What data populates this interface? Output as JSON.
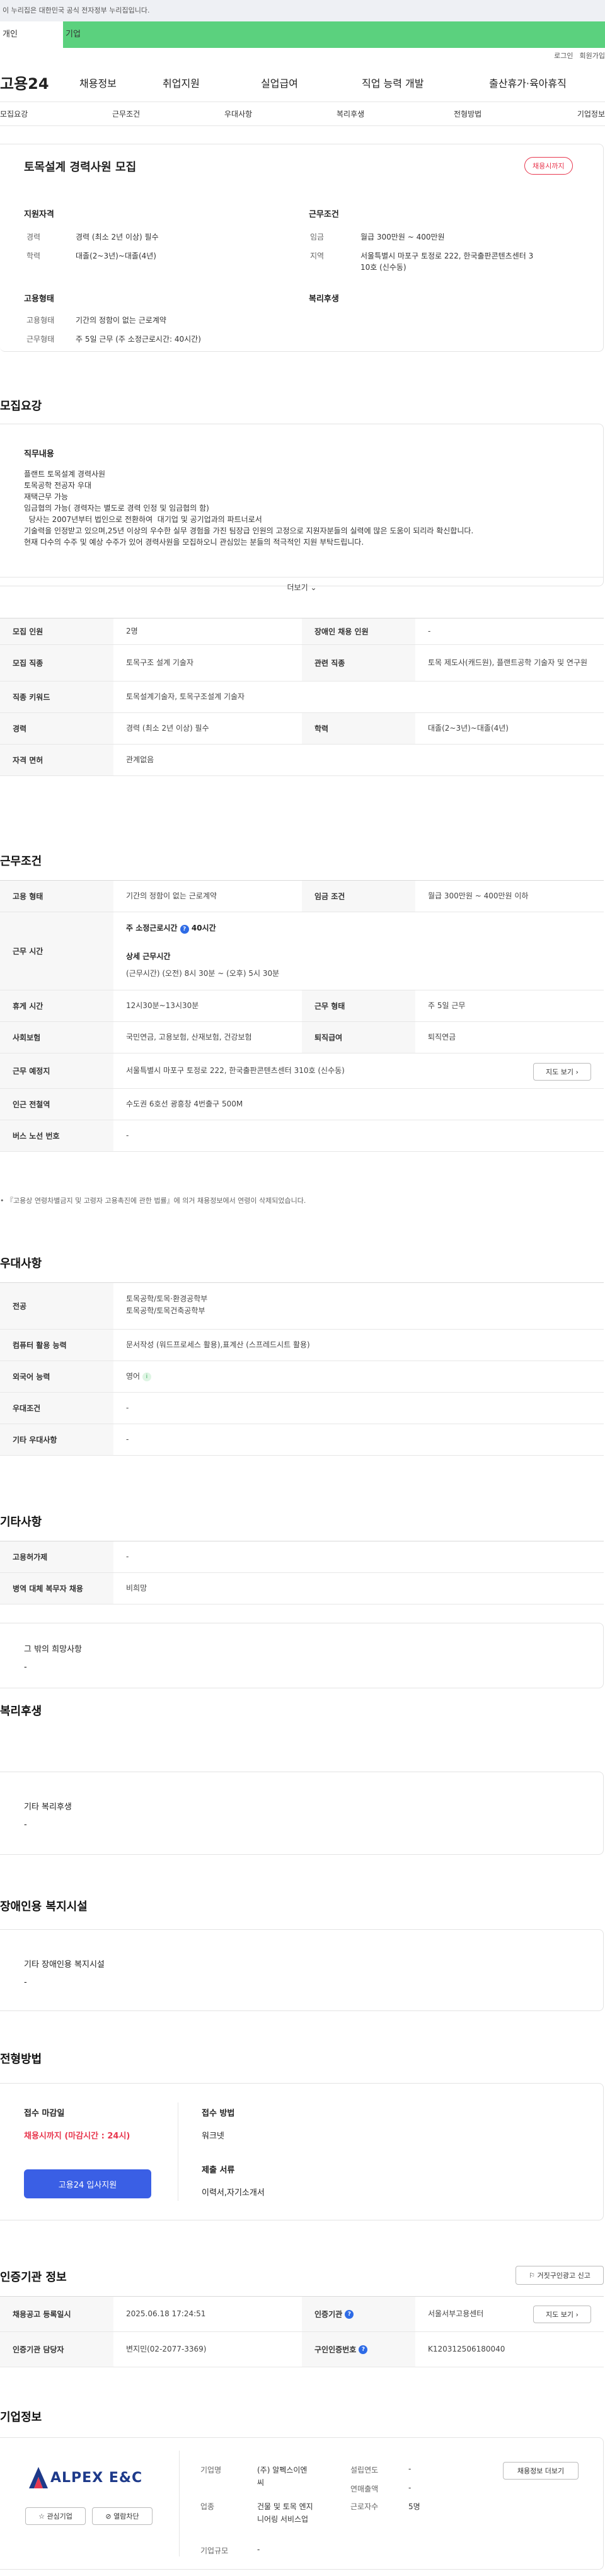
{
  "gov_notice": "이 누리집은 대한민국 공식 전자정부 누리집입니다.",
  "user_tabs": [
    "개인",
    "기업"
  ],
  "util": [
    "로그인",
    "회원가입"
  ],
  "logo": "고용24",
  "gnb": [
    "채용정보",
    "취업지원",
    "실업급여",
    "직업 능력 개발",
    "출산휴가·육아휴직"
  ],
  "subnav": [
    "모집요강",
    "근무조건",
    "우대사항",
    "복리후생",
    "전형방법",
    "기업정보"
  ],
  "job": {
    "title": "토목설계 경력사원 모집",
    "badge": "채용시까지"
  },
  "summary": {
    "qual_head": "지원자격",
    "cond_head": "근무조건",
    "emp_head": "고용형태",
    "welfare_head": "복리후생",
    "career_l": "경력",
    "career_v": "경력 (최소 2년 이상) 필수",
    "edu_l": "학력",
    "edu_v": "대졸(2~3년)~대졸(4년)",
    "wage_l": "임금",
    "wage_v": "월급 300만원 ~ 400만원",
    "loc_l": "지역",
    "loc_v1": "서울특별시 마포구 토정로 222, 한국출판콘텐츠센터 3",
    "loc_v2": "10호 (신수동)",
    "emptype_l": "고용형태",
    "emptype_v": "기간의 정함이 없는 근로계약",
    "worktype_l": "근무형태",
    "worktype_v": "주 5일 근무 (주 소정근로시간: 40시간)"
  },
  "recruit": {
    "title": "모집요강",
    "duty_head": "직무내용",
    "lines": [
      "플랜트 토목설계 경력사원",
      "토목공학 전공자 우대",
      "재택근무 가능",
      "임금협의 가능( 경력자는 별도로 경력 인정 및 임금협의 함)",
      "  당사는 2007년부터 법인으로 전환하여  대기업 및 공기업과의 파트너로서",
      "기술력을 인정받고 있으며,25년 이상의 우수한 실무 경험을 가진 팀장급 인원의 고정으로 지원자분들의 실력에 많은 도움이 되리라 확신합니다.",
      "현재 다수의 수주 및 예상 수주가 있어 경력사원을 모집하오니  관심있는 분들의 적극적인 지원 부탁드립니다."
    ],
    "more": "더보기",
    "rows": [
      {
        "th": "모집 인원",
        "td": "2명",
        "th2": "장애인 채용 인원",
        "td2": "-"
      },
      {
        "th": "모집 직종",
        "td": "토목구조 설계 기술자",
        "th2": "관련 직종",
        "td2": "토목 제도사(캐드원), 플랜트공학 기술자 및 연구원"
      },
      {
        "th": "직종 키워드",
        "td": "토목설계기술자, 토목구조설계 기술자"
      },
      {
        "th": "경력",
        "td": "경력 (최소 2년 이상) 필수",
        "th2": "학력",
        "td2": "대졸(2~3년)~대졸(4년)"
      },
      {
        "th": "자격 면허",
        "td": "관계없음"
      }
    ]
  },
  "work": {
    "title": "근무조건",
    "emp_th": "고용 형태",
    "emp_td": "기간의 정함이 없는 근로계약",
    "wage_th": "임금 조건",
    "wage_td": "월급 300만원 ~ 400만원 이하",
    "time_th": "근무 시간",
    "time_a": "주 소정근로시간",
    "time_b": "40시간",
    "time_c": "상세 근무시간",
    "time_d": "(근무시간) (오전) 8시 30분 ~ (오후) 5시 30분",
    "rest_th": "휴게 시간",
    "rest_td": "12시30분~13시30분",
    "form_th": "근무 형태",
    "form_td": "주 5일 근무",
    "ins_th": "사회보험",
    "ins_td": "국민연금, 고용보험, 산재보험, 건강보험",
    "ret_th": "퇴직급여",
    "ret_td": "퇴직연금",
    "place_th": "근무 예정지",
    "place_td": "서울특별시 마포구 토정로 222, 한국출판콘텐츠센터 310호 (신수동)",
    "map": "지도 보기",
    "sub_th": "인근 전철역",
    "sub_td": "수도권 6호선 광흥창 4번출구 500M",
    "bus_th": "버스 노선 번호",
    "bus_td": "-",
    "note": "『고용상 연령차별금지 및 고령자 고용촉진에 관한 법률』에 의거 채용정보에서 연령이 삭제되었습니다."
  },
  "pref": {
    "title": "우대사항",
    "major_th": "전공",
    "major_1": "토목공학/토목·환경공학부",
    "major_2": "토목공학/토목건축공학부",
    "pc_th": "컴퓨터 활용 능력",
    "pc_td": "문서작성 (워드프로세스 활용),표계산 (스프레드시트 활용)",
    "lang_th": "외국어 능력",
    "lang_td": "영어",
    "cond_th": "우대조건",
    "cond_td": "-",
    "etc_th": "기타 우대사항",
    "etc_td": "-"
  },
  "other": {
    "title": "기타사항",
    "dis_th": "고용허가제",
    "dis_td": "-",
    "mil_th": "병역 대체 복무자 채용",
    "mil_td": "비희망",
    "etc_head": "그 밖의 희망사항",
    "etc_v": "-"
  },
  "welfare": {
    "title": "복리후생",
    "head": "기타 복리후생",
    "v": "-"
  },
  "disab": {
    "title": "장애인용 복지시설",
    "head": "기타 장애인용 복지시설",
    "v": "-"
  },
  "process": {
    "title": "전형방법",
    "dead_head": "접수 마감일",
    "dead_v": "채용시까지 (마감시간 : 24시)",
    "apply_btn": "고용24 입사지원",
    "method_head": "접수 방법",
    "method_v": "워크넷",
    "doc_head": "제출 서류",
    "doc_v": "이력서,자기소개서"
  },
  "auth": {
    "title": "인증기관 정보",
    "report": "거짓구인광고 신고",
    "reg_th": "채용공고 등록일시",
    "reg_td": "2025.06.18 17:24:51",
    "org_th": "인증기관",
    "org_td": "서울서부고용센터",
    "map": "지도 보기",
    "mgr_th": "인증기관 담당자",
    "mgr_td": "변지민(02-2077-3369)",
    "no_th": "구인인증번호",
    "no_td": "K120312506180040"
  },
  "company": {
    "title": "기업정보",
    "logo_text": "ALPEX E&C",
    "fav": "관심기업",
    "block": "열람차단",
    "jobs": "채용정보 더보기",
    "name_l": "기업명",
    "name_v1": "(주) 알펙스이엔",
    "name_v2": "씨",
    "ind_l": "업종",
    "ind_v1": "건물 및 토목 엔지",
    "ind_v2": "니어링 서비스업",
    "size_l": "기업규모",
    "size_v": "-",
    "year_l": "설립연도",
    "year_v": "-",
    "sales_l": "연매출액",
    "sales_v": "-",
    "emp_l": "근로자수",
    "emp_v": "5명"
  },
  "colors": {
    "accent": "#5bd17e",
    "badge": "#e8384f",
    "blue": "#2e6be6",
    "button": "#3a5fe5"
  }
}
